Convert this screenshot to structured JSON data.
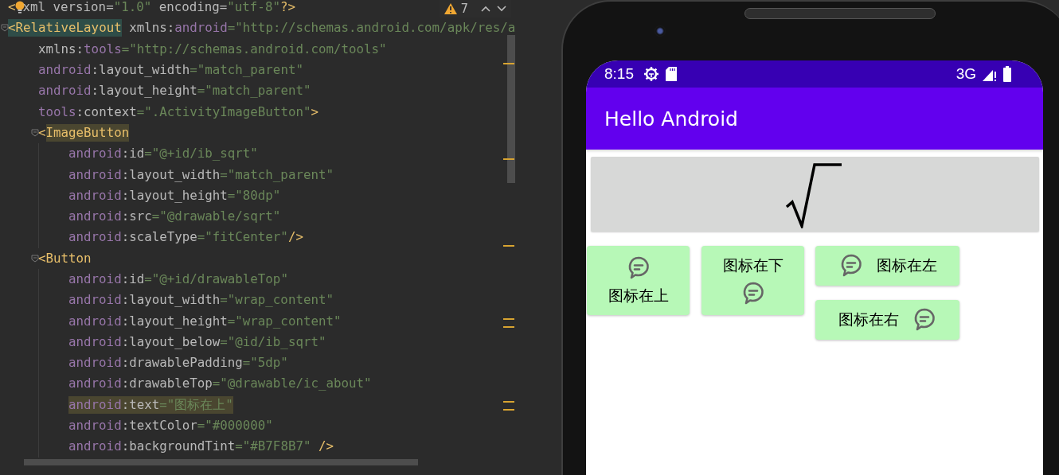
{
  "editor": {
    "inspections": {
      "count": "7"
    },
    "lines": [
      {
        "bulb": true,
        "tokens": [
          {
            "text": "<",
            "kind": "punct"
          },
          {
            "text": "xml version=",
            "kind": "plain"
          },
          {
            "text": "\"1.0\"",
            "kind": "string"
          },
          {
            "text": " encoding=",
            "kind": "plain"
          },
          {
            "text": "\"utf-8\"",
            "kind": "string"
          },
          {
            "text": "?>",
            "kind": "punct"
          }
        ]
      },
      {
        "tokens": [
          {
            "text": "<",
            "kind": "punct",
            "matched": true
          },
          {
            "text": "RelativeLayout",
            "kind": "tag",
            "matched": true
          },
          {
            "text": " xmlns:",
            "kind": "plain"
          },
          {
            "text": "android",
            "kind": "ns"
          },
          {
            "text": "=\"http://schemas.android.com/apk/res/a",
            "kind": "string"
          }
        ],
        "children": [
          {
            "tokens": [
              {
                "text": "xmlns:",
                "kind": "plain"
              },
              {
                "text": "tools",
                "kind": "ns"
              },
              {
                "text": "=\"http://schemas.android.com/tools\"",
                "kind": "string"
              }
            ]
          },
          {
            "tokens": [
              {
                "text": "android",
                "kind": "ns"
              },
              {
                "text": ":layout_width",
                "kind": "plain"
              },
              {
                "text": "=\"match_parent\"",
                "kind": "string"
              }
            ]
          },
          {
            "tokens": [
              {
                "text": "android",
                "kind": "ns"
              },
              {
                "text": ":layout_height",
                "kind": "plain"
              },
              {
                "text": "=\"match_parent\"",
                "kind": "string"
              }
            ]
          },
          {
            "tokens": [
              {
                "text": "tools",
                "kind": "ns"
              },
              {
                "text": ":context",
                "kind": "plain"
              },
              {
                "text": "=\".ActivityImageButton\"",
                "kind": "string"
              },
              {
                "text": ">",
                "kind": "punct"
              }
            ]
          },
          {
            "tokens": [
              {
                "text": "<",
                "kind": "punct"
              },
              {
                "text": "ImageButton",
                "kind": "tag",
                "highlighted": true
              }
            ],
            "children": [
              {
                "tokens": [
                  {
                    "text": "android",
                    "kind": "ns"
                  },
                  {
                    "text": ":id",
                    "kind": "plain"
                  },
                  {
                    "text": "=\"@+id/ib_sqrt\"",
                    "kind": "string"
                  }
                ]
              },
              {
                "tokens": [
                  {
                    "text": "android",
                    "kind": "ns"
                  },
                  {
                    "text": ":layout_width",
                    "kind": "plain"
                  },
                  {
                    "text": "=\"match_parent\"",
                    "kind": "string"
                  }
                ]
              },
              {
                "tokens": [
                  {
                    "text": "android",
                    "kind": "ns"
                  },
                  {
                    "text": ":layout_height",
                    "kind": "plain"
                  },
                  {
                    "text": "=\"80dp\"",
                    "kind": "string"
                  }
                ]
              },
              {
                "tokens": [
                  {
                    "text": "android",
                    "kind": "ns"
                  },
                  {
                    "text": ":src",
                    "kind": "plain"
                  },
                  {
                    "text": "=\"@drawable/sqrt\"",
                    "kind": "string"
                  }
                ]
              },
              {
                "tokens": [
                  {
                    "text": "android",
                    "kind": "ns"
                  },
                  {
                    "text": ":scaleType",
                    "kind": "plain"
                  },
                  {
                    "text": "=\"fitCenter\"",
                    "kind": "string"
                  },
                  {
                    "text": "/>",
                    "kind": "punct"
                  }
                ]
              }
            ]
          },
          {
            "tokens": [
              {
                "text": "<",
                "kind": "punct"
              },
              {
                "text": "Button",
                "kind": "tag"
              }
            ],
            "children": [
              {
                "tokens": [
                  {
                    "text": "android",
                    "kind": "ns"
                  },
                  {
                    "text": ":id",
                    "kind": "plain"
                  },
                  {
                    "text": "=\"@+id/drawableTop\"",
                    "kind": "string"
                  }
                ]
              },
              {
                "tokens": [
                  {
                    "text": "android",
                    "kind": "ns"
                  },
                  {
                    "text": ":layout_width",
                    "kind": "plain"
                  },
                  {
                    "text": "=\"wrap_content\"",
                    "kind": "string"
                  }
                ]
              },
              {
                "tokens": [
                  {
                    "text": "android",
                    "kind": "ns"
                  },
                  {
                    "text": ":layout_height",
                    "kind": "plain"
                  },
                  {
                    "text": "=\"wrap_content\"",
                    "kind": "string"
                  }
                ]
              },
              {
                "tokens": [
                  {
                    "text": "android",
                    "kind": "ns"
                  },
                  {
                    "text": ":layout_below",
                    "kind": "plain"
                  },
                  {
                    "text": "=\"@id/ib_sqrt\"",
                    "kind": "string"
                  }
                ]
              },
              {
                "tokens": [
                  {
                    "text": "android",
                    "kind": "ns"
                  },
                  {
                    "text": ":drawablePadding",
                    "kind": "plain"
                  },
                  {
                    "text": "=\"5dp\"",
                    "kind": "string"
                  }
                ]
              },
              {
                "tokens": [
                  {
                    "text": "android",
                    "kind": "ns"
                  },
                  {
                    "text": ":drawableTop",
                    "kind": "plain"
                  },
                  {
                    "text": "=\"@drawable/ic_about\"",
                    "kind": "string"
                  }
                ]
              },
              {
                "tokens": [
                  {
                    "text": "android",
                    "kind": "ns",
                    "highlighted": true
                  },
                  {
                    "text": ":text",
                    "kind": "plain",
                    "highlighted": true
                  },
                  {
                    "text": "=\"图标在上\"",
                    "kind": "string",
                    "highlighted": true
                  }
                ]
              },
              {
                "tokens": [
                  {
                    "text": "android",
                    "kind": "ns"
                  },
                  {
                    "text": ":textColor",
                    "kind": "plain"
                  },
                  {
                    "text": "=\"#000000\"",
                    "kind": "string"
                  }
                ]
              },
              {
                "tokens": [
                  {
                    "text": "android",
                    "kind": "ns"
                  },
                  {
                    "text": ":backgroundTint",
                    "kind": "plain"
                  },
                  {
                    "text": "=\"#B7F8B7\"",
                    "kind": "string"
                  },
                  {
                    "text": " />",
                    "kind": "punct"
                  }
                ]
              }
            ]
          }
        ]
      }
    ]
  },
  "phone": {
    "status_bar": {
      "time": "8:15",
      "network": "3G"
    },
    "app_bar": {
      "title": "Hello Android"
    },
    "buttons": [
      {
        "text": "图标在上",
        "kind": "icon-top"
      },
      {
        "text": "图标在下",
        "kind": "icon-bottom"
      },
      {
        "text": "图标在左",
        "kind": "icon-left"
      },
      {
        "text": "图标在右",
        "kind": "icon-right"
      }
    ]
  }
}
